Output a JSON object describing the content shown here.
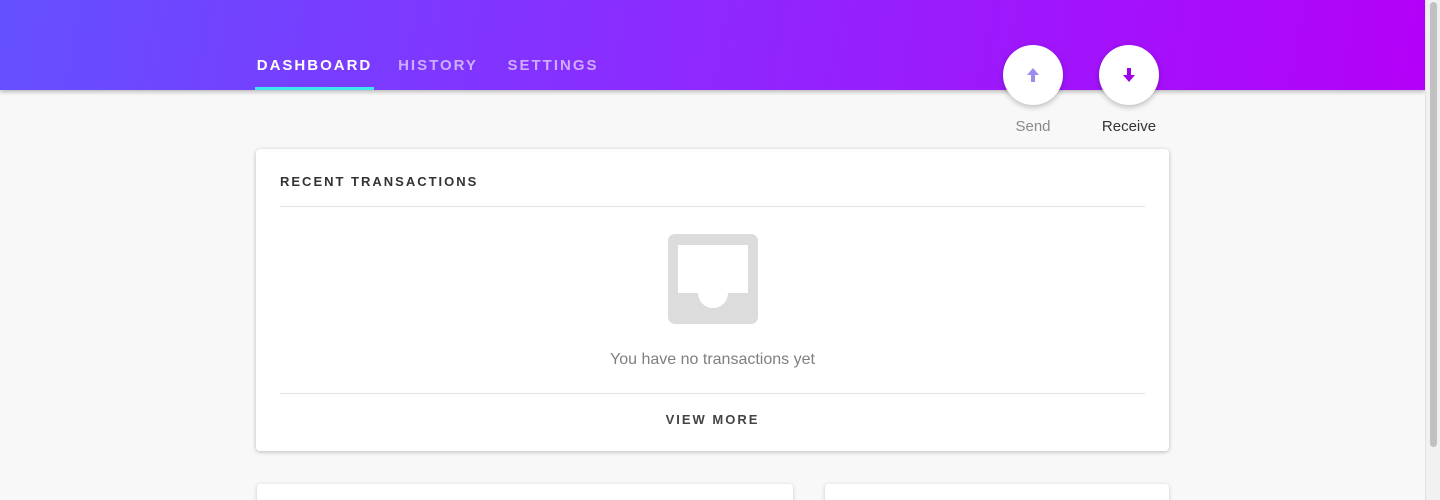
{
  "nav": {
    "tabs": [
      {
        "label": "DASHBOARD",
        "active": true
      },
      {
        "label": "HISTORY",
        "active": false
      },
      {
        "label": "SETTINGS",
        "active": false
      }
    ]
  },
  "actions": {
    "send_label": "Send",
    "receive_label": "Receive"
  },
  "recent_transactions": {
    "title": "RECENT TRANSACTIONS",
    "empty_message": "You have no transactions yet",
    "view_more_label": "VIEW MORE"
  },
  "colors": {
    "header_gradient_start": "#6450ff",
    "header_gradient_end": "#b400f8",
    "active_tab_underline": "#3ee7ef",
    "send_icon": "#9b8cf0",
    "receive_icon": "#a000e8"
  },
  "icons": {
    "send": "arrow-up-icon",
    "receive": "arrow-down-icon",
    "empty": "inbox-tray-icon"
  }
}
